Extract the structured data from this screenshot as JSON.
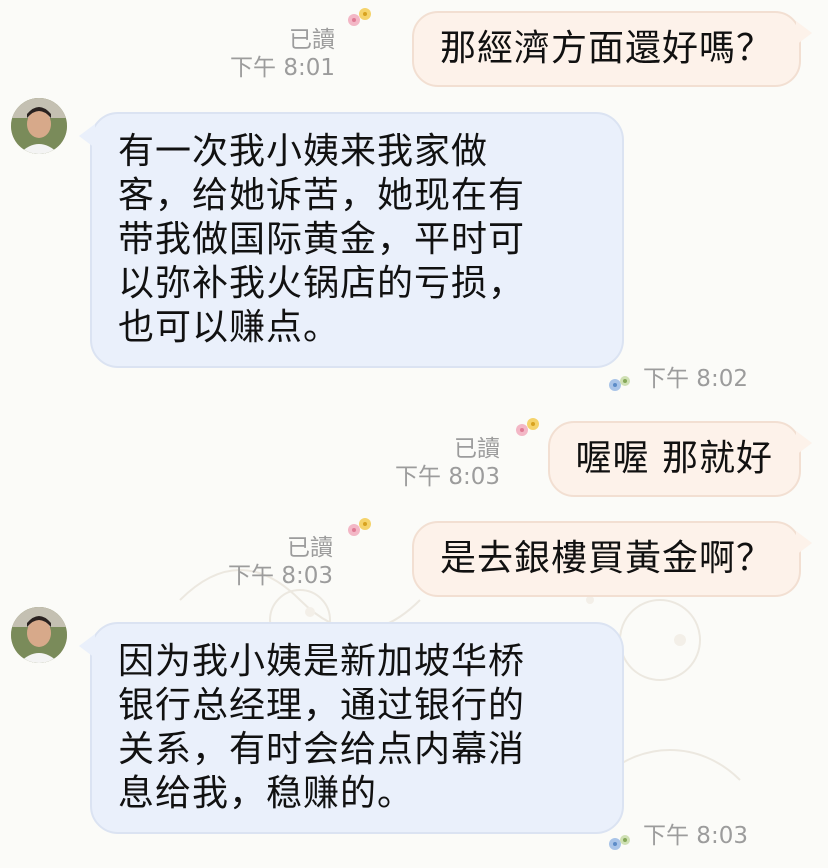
{
  "messages": [
    {
      "direction": "outgoing",
      "read_label": "已讀",
      "time": "下午 8:01",
      "text": "那經濟方面還好嗎？"
    },
    {
      "direction": "incoming",
      "time": "下午 8:02",
      "lines": [
        "有一次我小姨来我家做",
        "客，给她诉苦，她现在有",
        "带我做国际黄金，平时可",
        "以弥补我火锅店的亏损，",
        "也可以赚点。"
      ]
    },
    {
      "direction": "outgoing",
      "read_label": "已讀",
      "time": "下午 8:03",
      "text": "喔喔 那就好"
    },
    {
      "direction": "outgoing",
      "read_label": "已讀",
      "time": "下午 8:03",
      "text": "是去銀樓買黃金啊？"
    },
    {
      "direction": "incoming",
      "time": "下午 8:03",
      "lines": [
        "因为我小姨是新加坡华桥",
        "银行总经理，通过银行的",
        "关系，有时会给点内幕消",
        "息给我，稳赚的。"
      ]
    }
  ],
  "colors": {
    "outgoing_bubble": "#fdf2ea",
    "incoming_bubble": "#eaf0fb",
    "meta_text": "#9c9c9c"
  },
  "icons": {
    "outgoing_decoration": "flower-sticker-icon",
    "incoming_decoration": "flower-sticker-icon",
    "avatar": "contact-avatar"
  }
}
